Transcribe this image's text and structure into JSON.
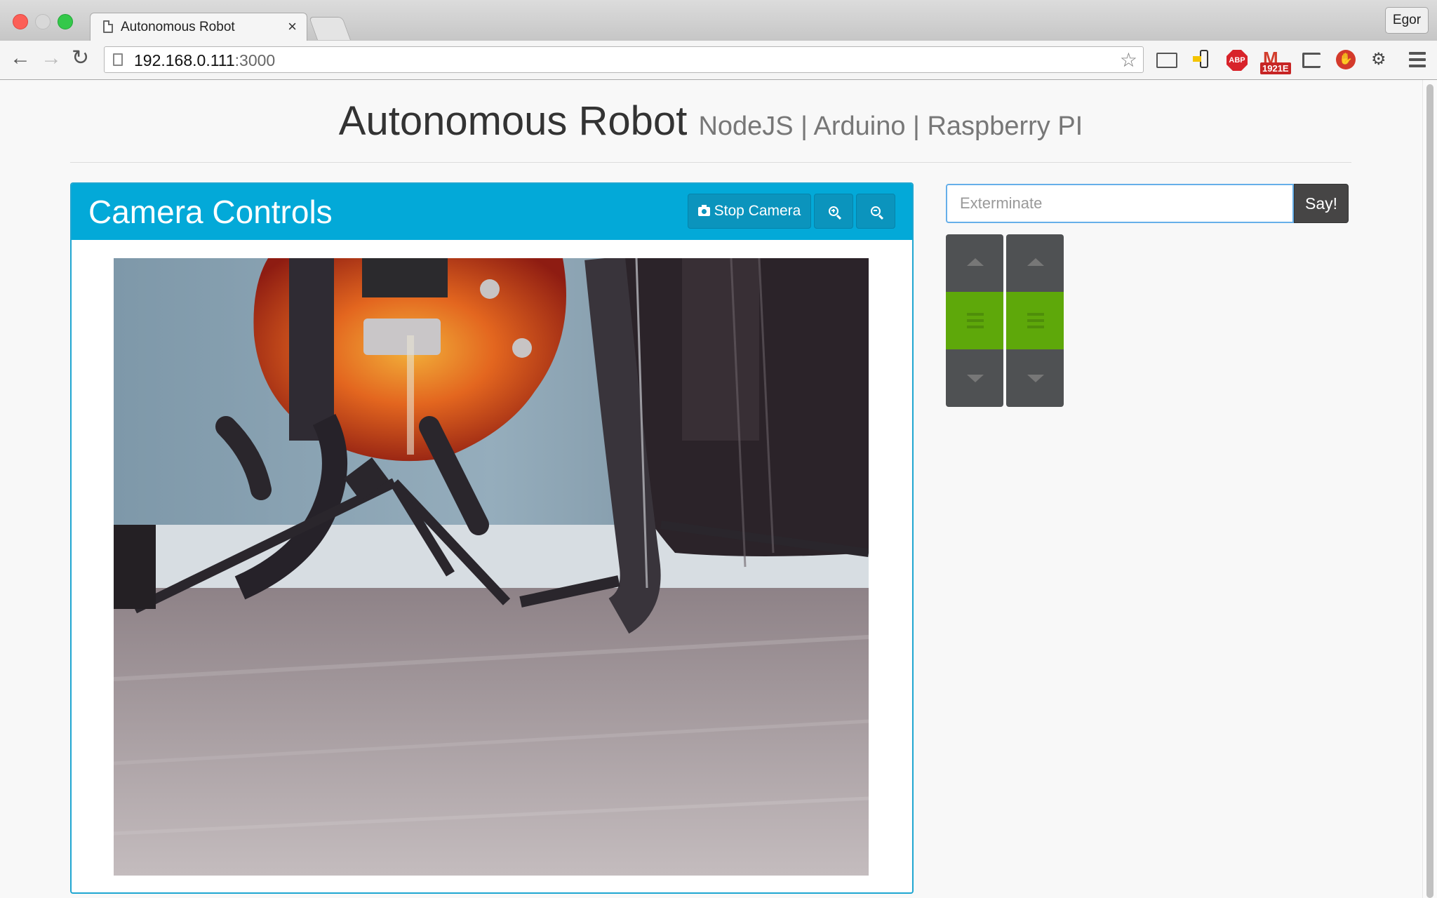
{
  "browser": {
    "tab_title": "Autonomous Robot",
    "tab_close": "×",
    "user_name": "Egor",
    "url_host": "192.168.0.111",
    "url_port": ":3000",
    "gmail_count": "1921E",
    "abp_label": "ABP",
    "nav": {
      "back": "←",
      "forward": "→",
      "reload": "↻"
    },
    "bookmark_star": "☆"
  },
  "header": {
    "title": "Autonomous Robot",
    "subtitle": "NodeJS | Arduino | Raspberry PI"
  },
  "camera_panel": {
    "title": "Camera Controls",
    "stop_camera_label": "Stop Camera",
    "zoom_in_icon": "zoom-in-icon",
    "zoom_out_icon": "zoom-out-icon"
  },
  "speech": {
    "placeholder": "Exterminate",
    "button_label": "Say!"
  },
  "motors": {
    "left": {
      "state": "stop"
    },
    "right": {
      "state": "stop"
    },
    "active_color": "#5ea80a",
    "inactive_color": "#4f5153"
  },
  "colors": {
    "panel_header": "#03a9d8",
    "panel_border": "#1fa6d1"
  }
}
